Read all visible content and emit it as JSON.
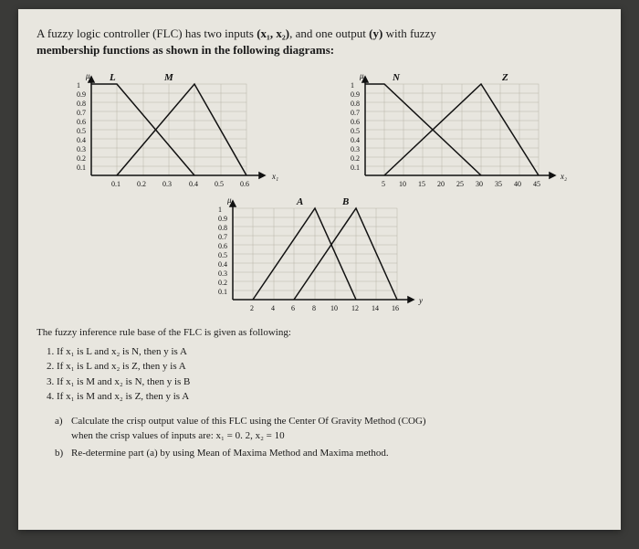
{
  "header": {
    "line1_pre": "A fuzzy logic controller (FLC) has two inputs ",
    "inputs": "(x₁, x₂)",
    "line1_mid": ", and one output ",
    "output": "(y)",
    "line1_post": " with fuzzy",
    "line2": "membership functions as shown in the following diagrams:"
  },
  "chart_data": [
    {
      "type": "line",
      "title": "",
      "xlabel": "x₁",
      "ylabel": "μ",
      "series": [
        {
          "name": "L",
          "x": [
            0,
            0.1,
            0.4
          ],
          "y": [
            1.0,
            1.0,
            0.0
          ]
        },
        {
          "name": "M",
          "x": [
            0.1,
            0.4,
            0.6
          ],
          "y": [
            0.0,
            1.0,
            0.0
          ]
        }
      ],
      "xlim": [
        0,
        0.6
      ],
      "ylim": [
        0,
        1.0
      ],
      "yticks": [
        0.1,
        0.2,
        0.3,
        0.4,
        0.5,
        0.6,
        0.7,
        0.8,
        0.9,
        1.0
      ],
      "xticks": [
        0.1,
        0.2,
        0.3,
        0.4,
        0.5,
        0.6
      ]
    },
    {
      "type": "line",
      "title": "",
      "xlabel": "x₂",
      "ylabel": "μ",
      "series": [
        {
          "name": "N",
          "x": [
            0,
            5,
            30
          ],
          "y": [
            1.0,
            1.0,
            0.0
          ]
        },
        {
          "name": "Z",
          "x": [
            5,
            30,
            45
          ],
          "y": [
            0.0,
            1.0,
            0.0
          ]
        }
      ],
      "xlim": [
        0,
        45
      ],
      "ylim": [
        0,
        1.0
      ],
      "yticks": [
        0.1,
        0.2,
        0.3,
        0.4,
        0.5,
        0.6,
        0.7,
        0.8,
        0.9,
        1.0
      ],
      "xticks": [
        5,
        10,
        15,
        20,
        25,
        30,
        35,
        40,
        45
      ]
    },
    {
      "type": "line",
      "title": "",
      "xlabel": "y",
      "ylabel": "μ",
      "series": [
        {
          "name": "A",
          "x": [
            2,
            8,
            12
          ],
          "y": [
            0.0,
            1.0,
            0.0
          ]
        },
        {
          "name": "B",
          "x": [
            6,
            12,
            16
          ],
          "y": [
            0.0,
            1.0,
            0.0
          ]
        }
      ],
      "xlim": [
        0,
        16
      ],
      "ylim": [
        0,
        1.0
      ],
      "yticks": [
        0.1,
        0.2,
        0.3,
        0.4,
        0.5,
        0.6,
        0.7,
        0.8,
        0.9,
        1.0
      ],
      "xticks": [
        2,
        4,
        6,
        8,
        10,
        12,
        14,
        16
      ]
    }
  ],
  "rules": {
    "intro": "The fuzzy inference rule base of the FLC is given as following:",
    "items": [
      "If x₁ is L and x₂ is N, then y is A",
      "If x₁ is L and x₂ is Z, then y is A",
      "If x₁ is M and x₂ is N, then y is B",
      "If x₁ is M and x₂ is Z, then y is A"
    ]
  },
  "questions": {
    "a": {
      "line1": "Calculate the crisp output value of this FLC using the Center Of Gravity Method (COG)",
      "line2": "when the crisp values of inputs are: x₁ = 0. 2,  x₂ = 10"
    },
    "b": "Re-determine part (a) by using Mean of Maxima Method and Maxima method."
  }
}
